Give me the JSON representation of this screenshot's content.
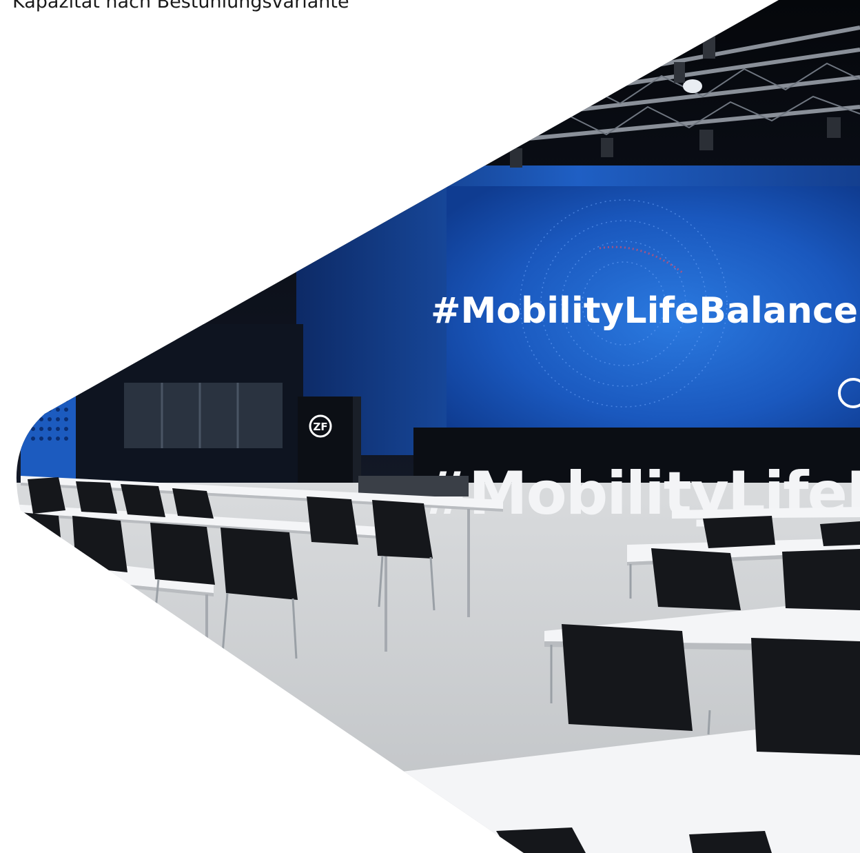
{
  "page": {
    "heading": "Kapazität nach Bestuhlungsvariante"
  },
  "photo": {
    "screen_hashtag": "#MobilityLifeBalance",
    "stage_letters": "#MobilityLifeBala",
    "lectern_logo": "ZF",
    "screen_logo": "ZF"
  },
  "colors": {
    "background": "#ffffff",
    "wall_blue": "#1f5fc4",
    "screen_blue": "#1e63c9",
    "hall_dark": "#111722",
    "chair_black": "#15171b",
    "table_white": "#f4f5f7",
    "floor_grey": "#c9cbcd"
  }
}
